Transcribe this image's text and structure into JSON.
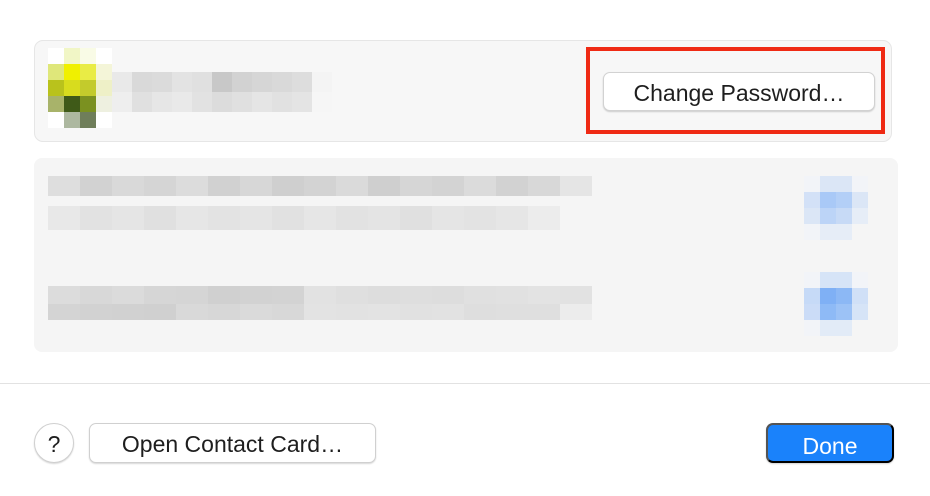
{
  "dialog": {
    "account_card": {
      "change_password_label": "Change Password…",
      "highlight_color": "#ef2a14"
    },
    "footer": {
      "help_label": "?",
      "open_contact_card_label": "Open Contact Card…",
      "done_label": "Done"
    }
  },
  "colors": {
    "accent": "#1a82fb",
    "highlight": "#ef2a14"
  }
}
